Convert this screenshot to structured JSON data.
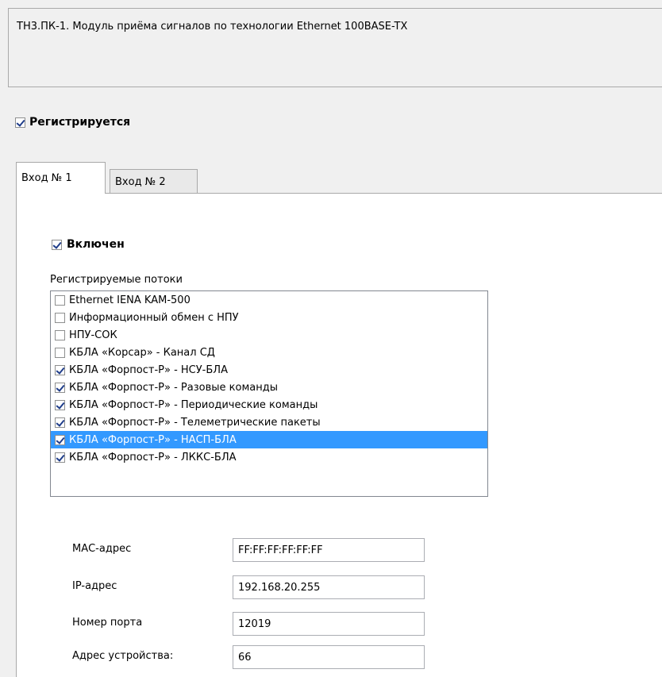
{
  "module_description": "ТН3.ПК-1. Модуль приёма сигналов по технологии Ethernet 100BASE-TX",
  "registered": {
    "label": "Регистрируется",
    "checked": true
  },
  "tabs": [
    {
      "label": "Вход № 1",
      "active": true
    },
    {
      "label": "Вход № 2",
      "active": false
    }
  ],
  "input": {
    "enabled": {
      "label": "Включен",
      "checked": true
    },
    "streams_label": "Регистрируемые потоки",
    "streams": [
      {
        "label": "Ethernet IENA KAM-500",
        "checked": false
      },
      {
        "label": "Информационный обмен с НПУ",
        "checked": false
      },
      {
        "label": "НПУ-СОК",
        "checked": false
      },
      {
        "label": "КБЛА «Корсар» - Канал СД",
        "checked": false
      },
      {
        "label": "КБЛА «Форпост-Р» - НСУ-БЛА",
        "checked": true
      },
      {
        "label": "КБЛА «Форпост-Р» - Разовые команды",
        "checked": true
      },
      {
        "label": "КБЛА «Форпост-Р» - Периодические команды",
        "checked": true
      },
      {
        "label": "КБЛА «Форпост-Р» - Телеметрические пакеты",
        "checked": true
      },
      {
        "label": "КБЛА «Форпост-Р» - НАСП-БЛА",
        "checked": true,
        "selected": true
      },
      {
        "label": "КБЛА «Форпост-Р» - ЛККС-БЛА",
        "checked": true
      }
    ],
    "fields": [
      {
        "label": "МАС-адрес",
        "value": "FF:FF:FF:FF:FF:FF"
      },
      {
        "label": "IP-адрес",
        "value": "192.168.20.255"
      },
      {
        "label": "Номер порта",
        "value": "12019"
      },
      {
        "label": "Адрес устройства:",
        "value": "66"
      }
    ]
  }
}
